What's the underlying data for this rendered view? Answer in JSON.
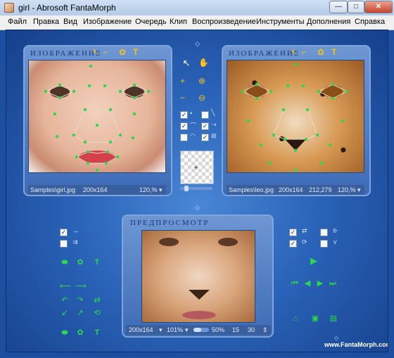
{
  "window": {
    "title": "girl - Abrosoft FantaMorph",
    "minimize_glyph": "—",
    "maximize_glyph": "□",
    "close_glyph": "✕"
  },
  "menu": [
    "Файл",
    "Правка",
    "Вид",
    "Изображение",
    "Очередь",
    "Клип",
    "Воспроизведение",
    "Инструменты",
    "Дополнения",
    "Справка"
  ],
  "source_panel": {
    "title": "ИЗОБРАЖЕНИЕ",
    "file": "Samples\\girl.jpg",
    "size": "200x164",
    "zoom": "120,%"
  },
  "target_panel": {
    "title": "ИЗОБРАЖЕНИЕ",
    "file": "Samples\\leo.jpg",
    "size": "200x164",
    "extra": "212,279",
    "zoom": "120,%"
  },
  "preview_panel": {
    "title": "ПРЕДПРОСМОТР",
    "size": "200x164",
    "zoom": "101%",
    "percent": "50%",
    "frame": "15",
    "total_frames": "30",
    "progress": 0.5
  },
  "website": "www.FantaMorph.com",
  "colors": {
    "accent_green": "#2bd94c",
    "panel_blue": "#3d6bb6",
    "tool_yellow": "#f3c21a"
  },
  "icons": [
    "pointer",
    "hand",
    "zoom-in",
    "zoom-in-glass",
    "zoom-out",
    "zoom-out-glass",
    "crop",
    "settings",
    "text",
    "play",
    "first",
    "prev",
    "next",
    "last",
    "camera",
    "film",
    "document"
  ]
}
